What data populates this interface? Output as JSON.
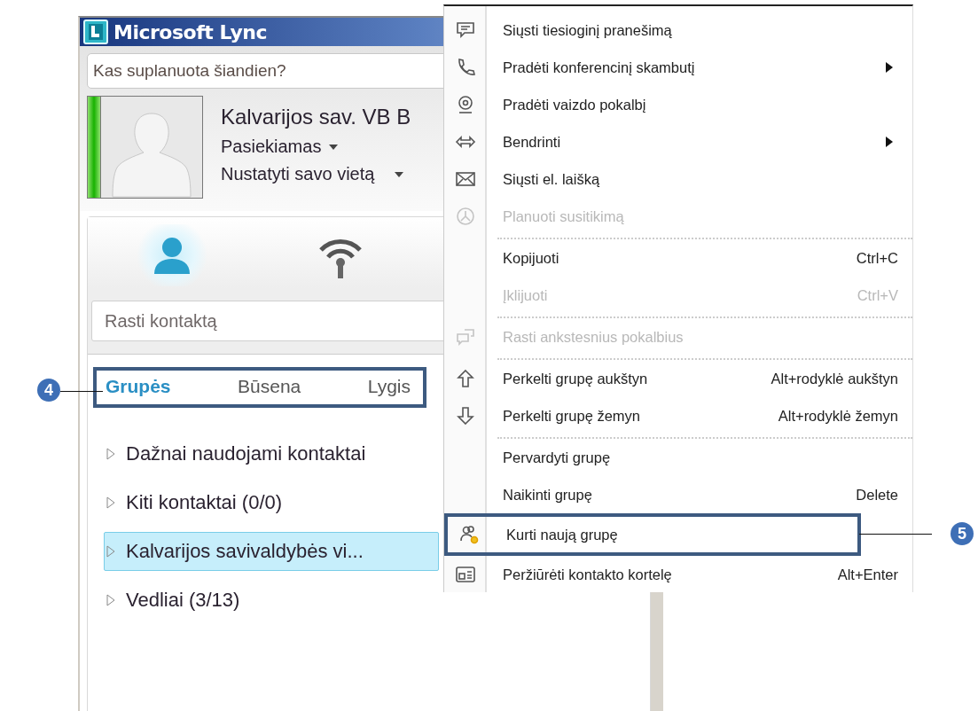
{
  "window": {
    "title": "Microsoft Lync"
  },
  "note": {
    "placeholder": "Kas suplanuota šiandien?"
  },
  "profile": {
    "name": "Kalvarijos sav. VB B",
    "presence_on": true,
    "status": "Pasiekiamas",
    "location": "Nustatyti savo vietą"
  },
  "views": [
    {
      "kind": "contacts",
      "selected": true
    },
    {
      "kind": "activity",
      "selected": false
    }
  ],
  "search": {
    "placeholder": "Rasti kontaktą"
  },
  "tabs": [
    {
      "label": "Grupės",
      "selected": true
    },
    {
      "label": "Būsena",
      "selected": false
    },
    {
      "label": "Lygis",
      "selected": false
    }
  ],
  "groups": [
    {
      "label": "Dažnai naudojami kontaktai",
      "selected": false
    },
    {
      "label": "Kiti kontaktai (0/0)",
      "selected": false
    },
    {
      "label": "Kalvarijos savivaldybės vi...",
      "selected": true
    },
    {
      "label": "Vedliai (3/13)",
      "selected": false
    }
  ],
  "context_menu": {
    "items": [
      {
        "kind": "item",
        "label": "Siųsti tiesioginį pranešimą",
        "disabled": false
      },
      {
        "kind": "item",
        "label": "Pradėti konferencinį skambutį",
        "submenu": true,
        "disabled": false
      },
      {
        "kind": "item",
        "label": "Pradėti vaizdo pokalbį",
        "disabled": false
      },
      {
        "kind": "item",
        "label": "Bendrinti",
        "submenu": true,
        "disabled": false
      },
      {
        "kind": "item",
        "label": "Siųsti el. laišką",
        "disabled": false
      },
      {
        "kind": "item",
        "label": "Planuoti susitikimą",
        "disabled": true
      },
      {
        "kind": "separator"
      },
      {
        "kind": "item",
        "label": "Kopijuoti",
        "shortcut": "Ctrl+C",
        "disabled": false
      },
      {
        "kind": "item",
        "label": "Įklijuoti",
        "shortcut": "Ctrl+V",
        "disabled": true
      },
      {
        "kind": "separator"
      },
      {
        "kind": "item",
        "label": "Rasti ankstesnius pokalbius",
        "disabled": true
      },
      {
        "kind": "separator"
      },
      {
        "kind": "item",
        "label": "Perkelti grupę aukštyn",
        "shortcut": "Alt+rodyklė aukštyn",
        "disabled": false
      },
      {
        "kind": "item",
        "label": "Perkelti grupę žemyn",
        "shortcut": "Alt+rodyklė žemyn",
        "disabled": false
      },
      {
        "kind": "separator"
      },
      {
        "kind": "item",
        "label": "Pervardyti grupę",
        "disabled": false
      },
      {
        "kind": "item",
        "label": "Naikinti grupę",
        "shortcut": "Delete",
        "disabled": false
      },
      {
        "kind": "item",
        "label": "Kurti naują grupę",
        "disabled": false,
        "outlined": true
      },
      {
        "kind": "item",
        "label": "Peržiūrėti kontakto kortelę",
        "shortcut": "Alt+Enter",
        "disabled": false
      }
    ]
  },
  "callouts": [
    {
      "number": "4"
    },
    {
      "number": "5"
    }
  ]
}
